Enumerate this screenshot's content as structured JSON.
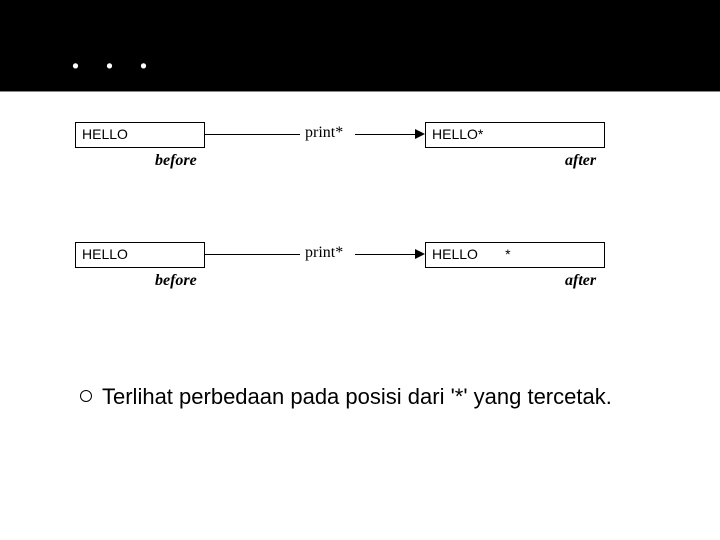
{
  "header": {
    "title": ". . ."
  },
  "diagrams": [
    {
      "left_box": "HELLO",
      "operation": "print*",
      "right_box": "HELLO*",
      "label_before": "before",
      "label_after": "after"
    },
    {
      "left_box": "HELLO",
      "operation": "print*",
      "right_box": "HELLO       *",
      "label_before": "before",
      "label_after": "after"
    }
  ],
  "bullet": {
    "text": "Terlihat perbedaan pada posisi dari '*' yang tercetak."
  }
}
